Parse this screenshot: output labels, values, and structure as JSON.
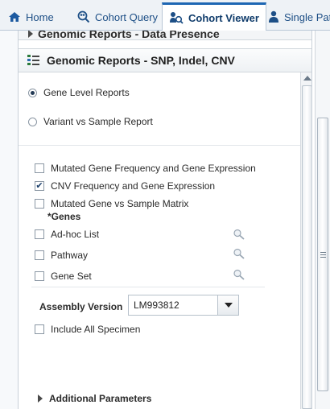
{
  "tabs": [
    {
      "label": "Home",
      "icon": "home-icon",
      "active": false
    },
    {
      "label": "Cohort Query",
      "icon": "cohort-query-icon",
      "active": false
    },
    {
      "label": "Cohort Viewer",
      "icon": "cohort-viewer-icon",
      "active": true
    },
    {
      "label": "Single Pat",
      "icon": "single-patient-icon",
      "active": false
    }
  ],
  "panel": {
    "clipped_section_title": "Genomic Reports - Data Presence",
    "section_title": "Genomic Reports - SNP, Indel, CNV",
    "report_options": [
      {
        "label": "Gene Level Reports",
        "selected": true
      },
      {
        "label": "Variant vs Sample Report",
        "selected": false
      }
    ],
    "report_checks": [
      {
        "label": "Mutated Gene Frequency and Gene Expression",
        "checked": false
      },
      {
        "label": "CNV Frequency and Gene Expression",
        "checked": true
      },
      {
        "label": "Mutated Gene vs Sample Matrix",
        "checked": false
      }
    ],
    "genes_label": "*Genes",
    "gene_checks": [
      {
        "label": "Ad-hoc List",
        "checked": false
      },
      {
        "label": "Pathway",
        "checked": false
      },
      {
        "label": "Gene Set",
        "checked": false
      }
    ],
    "assembly_label": "Assembly Version",
    "assembly_value": "LM993812",
    "include_all_label": "Include All Specimen",
    "additional_label": "Additional Parameters"
  },
  "colors": {
    "accent": "#1d66b3",
    "tab_text": "#1d4f86"
  }
}
